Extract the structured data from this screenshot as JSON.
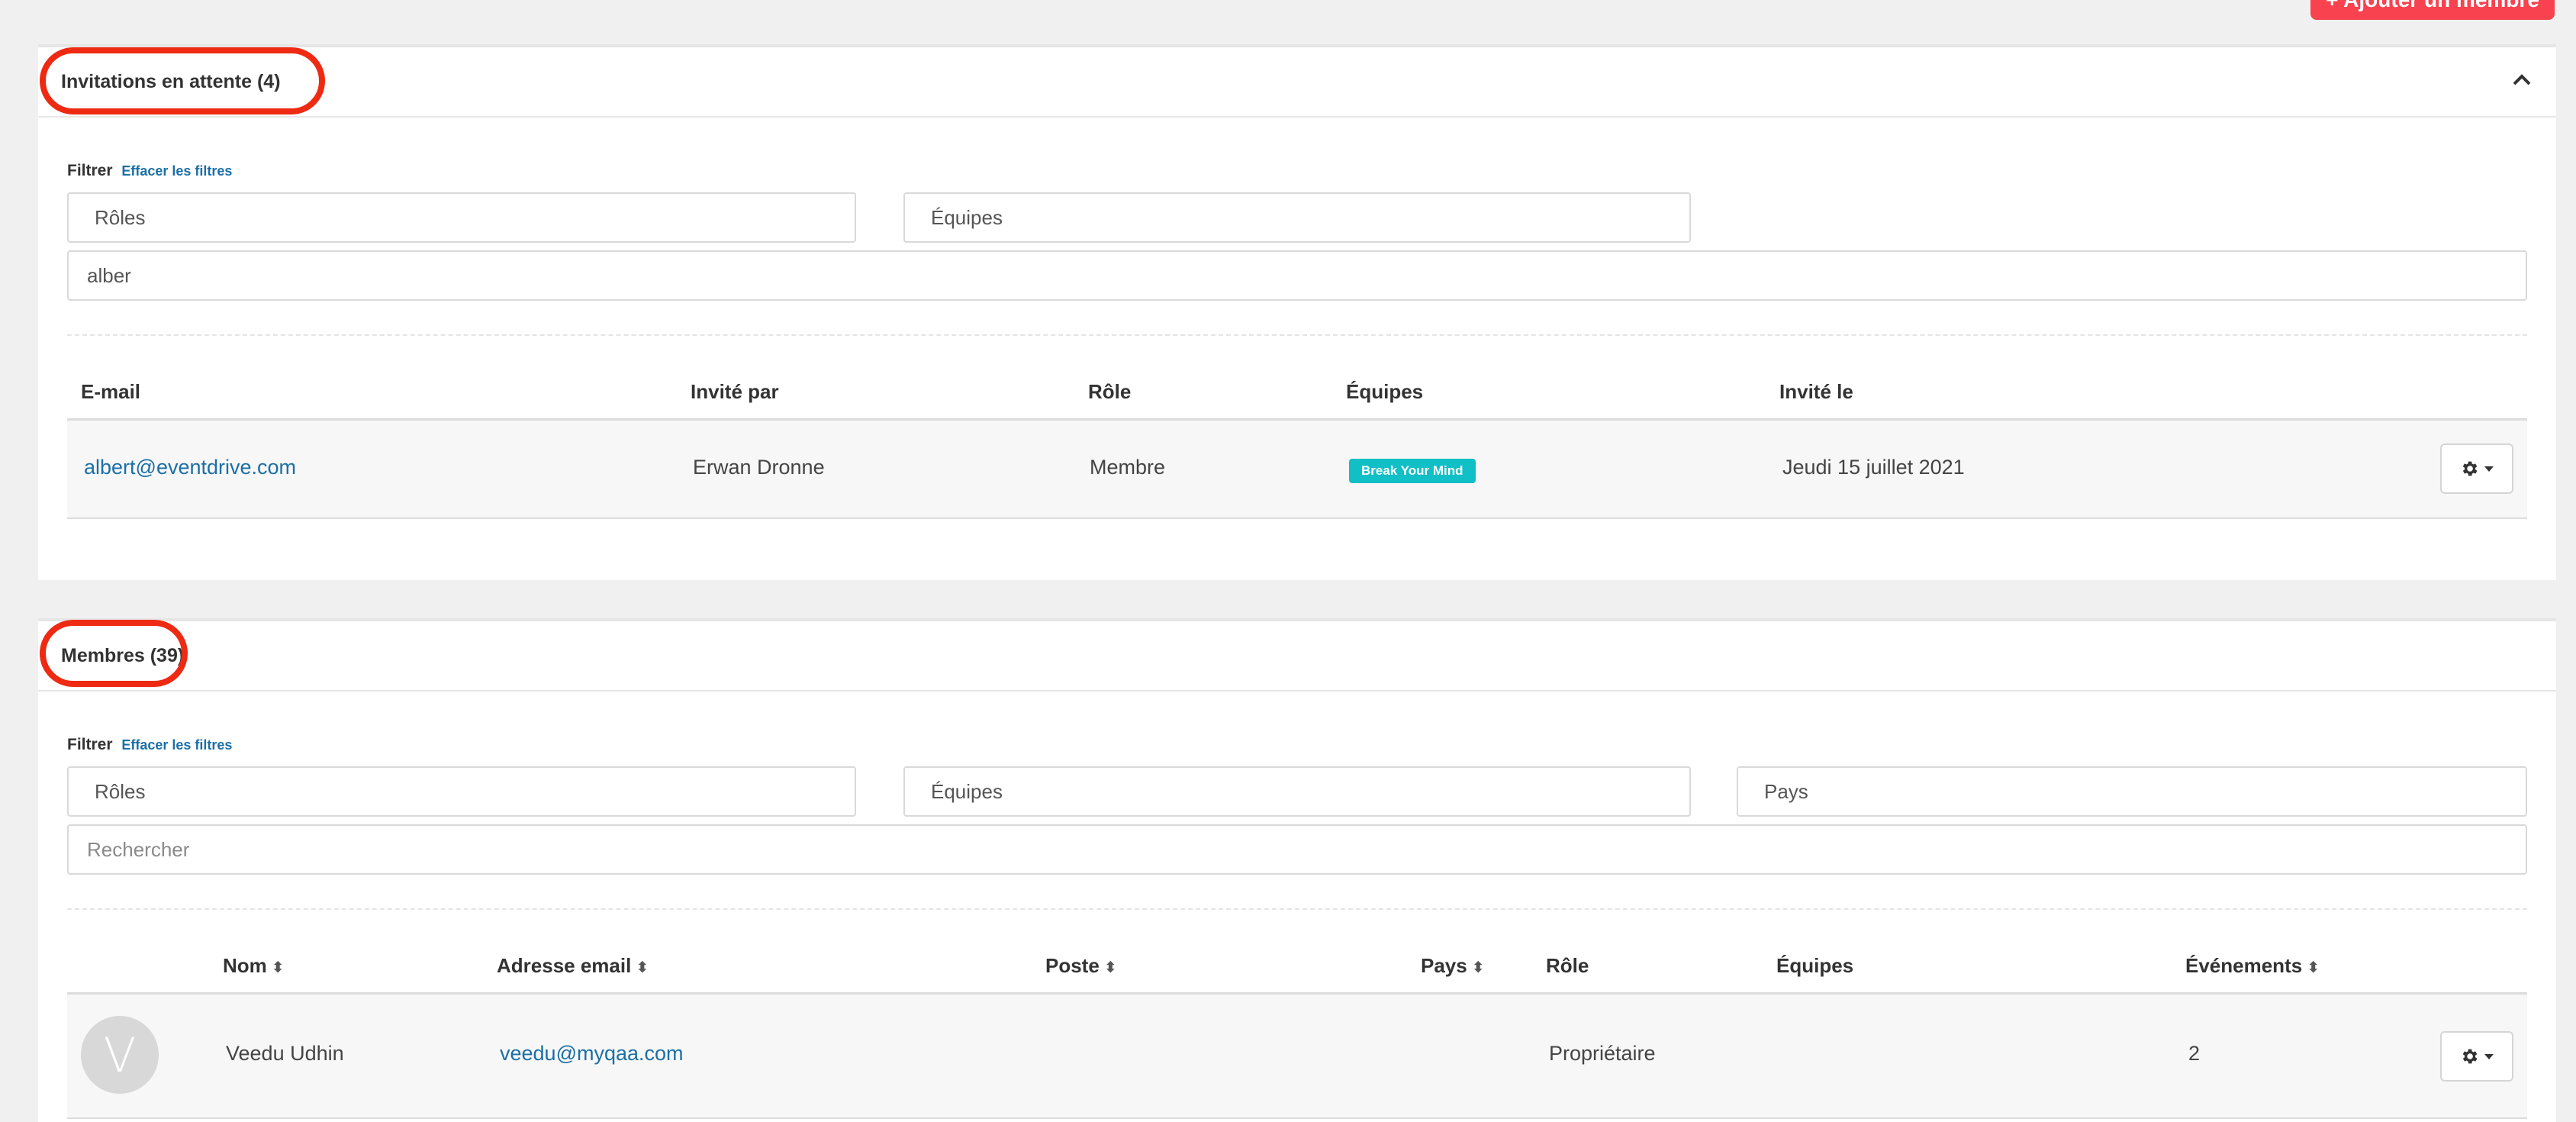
{
  "top_button": {
    "label": "+ Ajouter un membre"
  },
  "invitations": {
    "title": "Invitations en attente (4)",
    "filter_label": "Filtrer",
    "clear_filters": "Effacer les filtres",
    "roles_select": "Rôles",
    "teams_select": "Équipes",
    "search_value": "alber",
    "columns": {
      "email": "E-mail",
      "invited_by": "Invité par",
      "role": "Rôle",
      "teams": "Équipes",
      "invited_on": "Invité le"
    },
    "rows": [
      {
        "email": "albert@eventdrive.com",
        "invited_by": "Erwan Dronne",
        "role": "Membre",
        "team_badge": "Break Your Mind",
        "invited_on": "Jeudi 15 juillet 2021"
      }
    ]
  },
  "members": {
    "title": "Membres (39)",
    "filter_label": "Filtrer",
    "clear_filters": "Effacer les filtres",
    "roles_select": "Rôles",
    "teams_select": "Équipes",
    "country_select": "Pays",
    "search_placeholder": "Rechercher",
    "columns": {
      "name": "Nom",
      "email": "Adresse email",
      "position": "Poste",
      "country": "Pays",
      "role": "Rôle",
      "teams": "Équipes",
      "events": "Événements"
    },
    "rows": [
      {
        "avatar_letter": "V",
        "name": "Veedu Udhin",
        "email": "veedu@myqaa.com",
        "position": "",
        "country": "",
        "role": "Propriétaire",
        "teams": "",
        "events": "2"
      }
    ]
  },
  "colors": {
    "accent_red": "#f8424f",
    "circle_red": "#ee2a13",
    "link_blue": "#1b6fa6",
    "badge_teal": "#11bfc6"
  },
  "icons": [
    "chevron-up-icon",
    "gear-icon",
    "caret-down-icon",
    "sort-icon"
  ]
}
